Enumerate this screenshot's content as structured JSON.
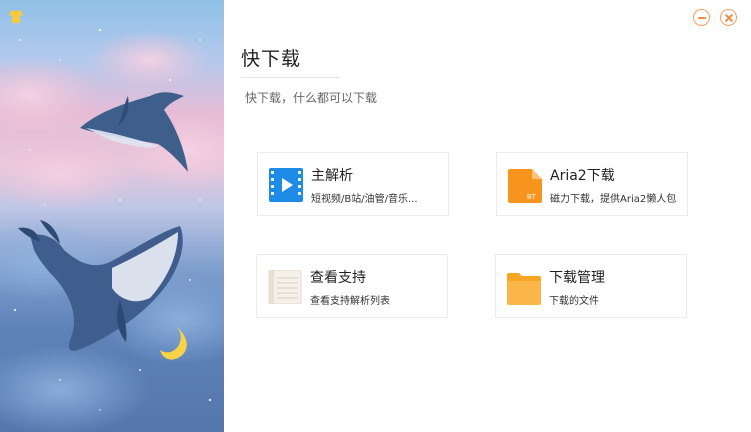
{
  "app": {
    "title": "快下载",
    "subtitle": "快下载，什么都可以下载"
  },
  "window_controls": {
    "minimize_icon": "minimize-icon",
    "close_icon": "close-icon",
    "accent_color": "#f08b3e"
  },
  "skin_icon": "shirt-icon",
  "cards": [
    {
      "name": "主解析",
      "desc": "短视频/B站/油管/音乐...",
      "icon": "video-play-icon",
      "color": "#1e8be6"
    },
    {
      "name": "Aria2下载",
      "desc": "磁力下载，提供Aria2懒人包",
      "icon": "bt-file-icon",
      "badge": "BT",
      "color": "#f7941d"
    },
    {
      "name": "查看支持",
      "desc": "查看支持解析列表",
      "icon": "notepad-icon",
      "color": "#f1ede4"
    },
    {
      "name": "下载管理",
      "desc": "下载的文件",
      "icon": "folder-icon",
      "color": "#fbb64a"
    }
  ]
}
